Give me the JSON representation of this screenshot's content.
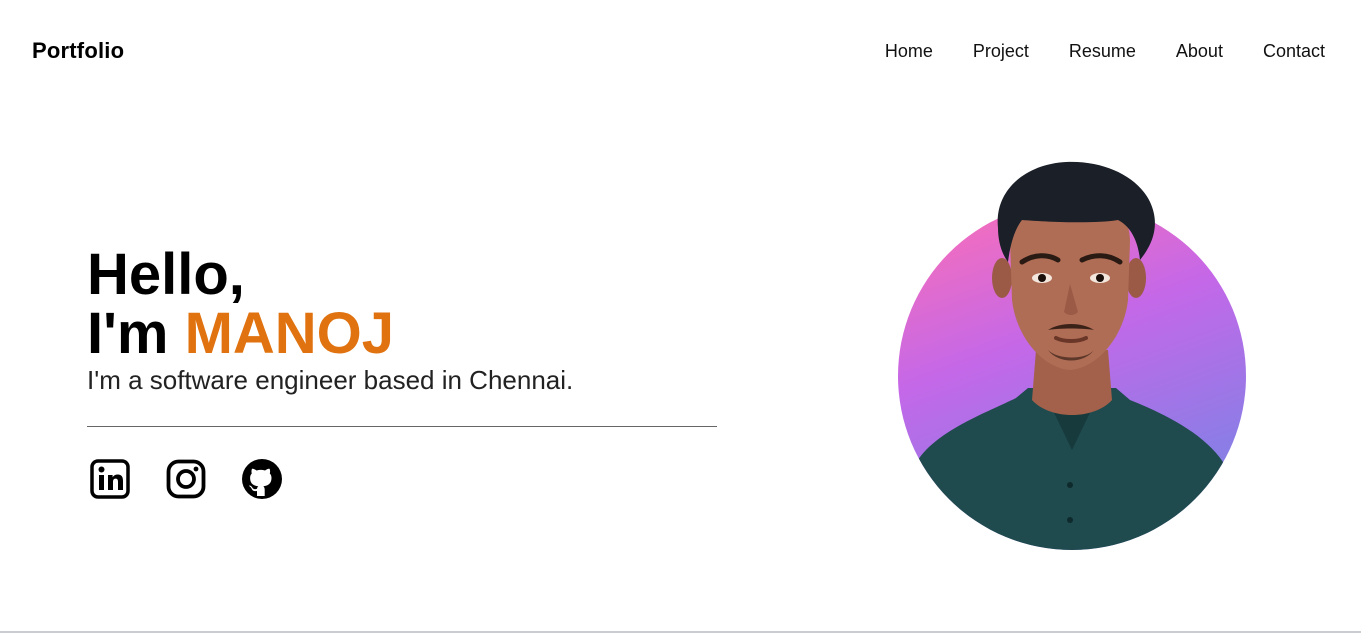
{
  "nav": {
    "brand": "Portfolio",
    "links": [
      "Home",
      "Project",
      "Resume",
      "About",
      "Contact"
    ]
  },
  "hero": {
    "greeting": "Hello,",
    "intro_prefix": "I'm ",
    "name": "MANOJ",
    "tagline": "I'm a software engineer based in Chennai."
  },
  "socials": [
    {
      "icon": "linkedin-icon"
    },
    {
      "icon": "instagram-icon"
    },
    {
      "icon": "github-icon"
    }
  ],
  "colors": {
    "accent": "#E0720F",
    "profile_gradient": [
      "#ff6fb3",
      "#c468e8",
      "#8e7ce6"
    ]
  }
}
